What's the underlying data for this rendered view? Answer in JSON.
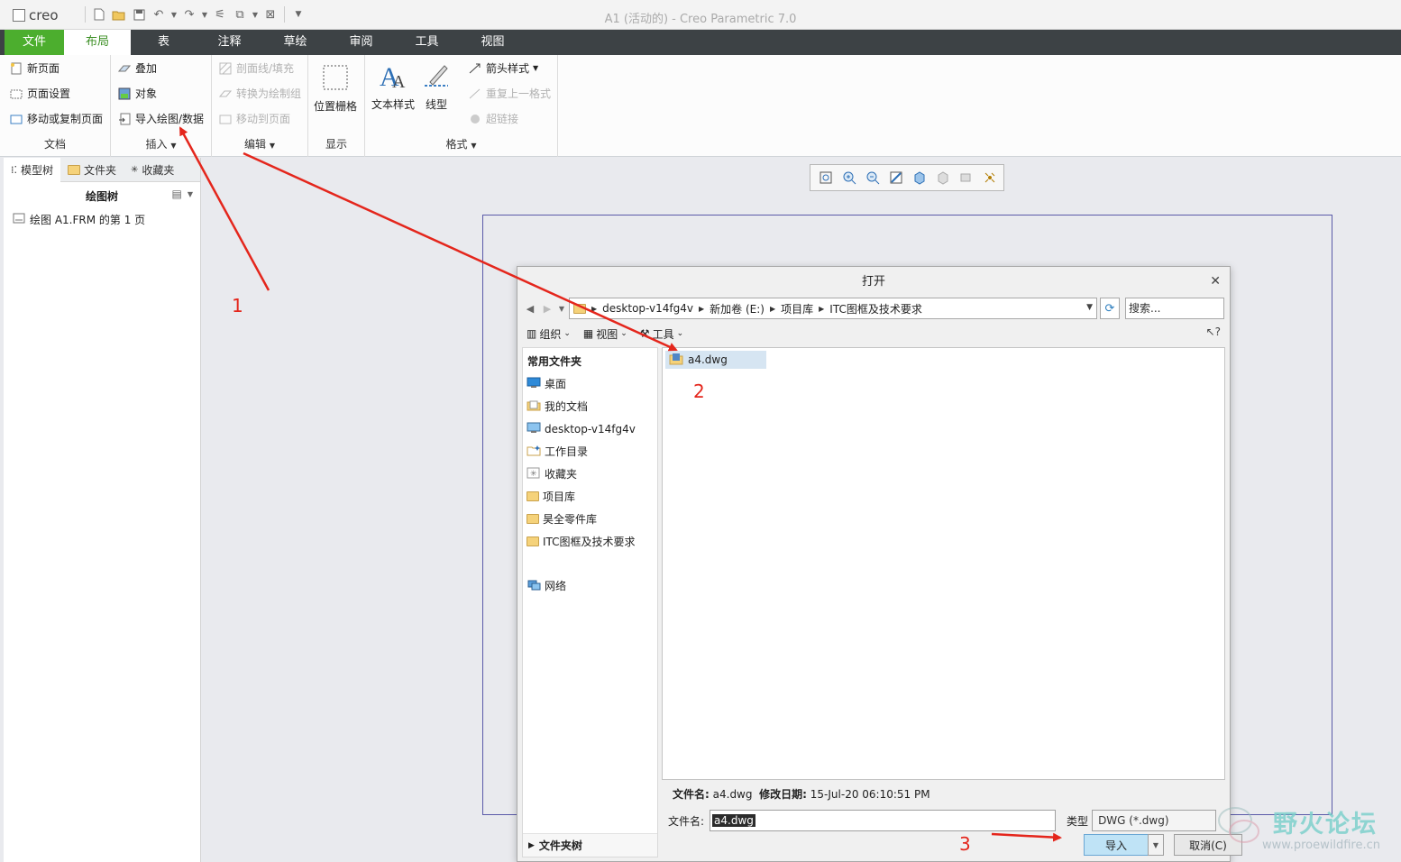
{
  "app": {
    "logo": "creo",
    "window_title": "A1 (活动的) - Creo Parametric 7.0"
  },
  "tabs": [
    "文件",
    "布局",
    "表",
    "注释",
    "草绘",
    "审阅",
    "工具",
    "视图"
  ],
  "ribbon": {
    "doc": {
      "new_page": "新页面",
      "page_setup": "页面设置",
      "move_copy": "移动或复制页面",
      "label": "文档"
    },
    "insert": {
      "overlay": "叠加",
      "object": "对象",
      "import": "导入绘图/数据",
      "label": "插入"
    },
    "edit": {
      "section_line": "剖面线/填充",
      "convert": "转换为绘制组",
      "move_to_page": "移动到页面",
      "label": "编辑"
    },
    "display": {
      "grid": "位置栅格",
      "label": "显示"
    },
    "format": {
      "text_style": "文本样式",
      "line_style": "线型",
      "arrow_style": "箭头样式",
      "repeat_format": "重复上一格式",
      "hyperlink": "超链接",
      "label": "格式"
    }
  },
  "left_panel": {
    "tabs": [
      "模型树",
      "文件夹",
      "收藏夹"
    ],
    "tree_title": "绘图树",
    "tree_item": "绘图 A1.FRM 的第 1 页"
  },
  "dialog": {
    "title": "打开",
    "path": [
      "desktop-v14fg4v",
      "新加卷 (E:)",
      "项目库",
      "ITC图框及技术要求"
    ],
    "search_placeholder": "搜索...",
    "tools": {
      "organize": "组织",
      "view": "视图",
      "tools": "工具",
      "help": "?"
    },
    "favorites_header": "常用文件夹",
    "favorites": [
      "桌面",
      "我的文档",
      "desktop-v14fg4v",
      "工作目录",
      "收藏夹",
      "项目库",
      "昊全零件库",
      "ITC图框及技术要求"
    ],
    "network": "网络",
    "folder_tree": "文件夹树",
    "files": [
      "a4.dwg"
    ],
    "info_label_name": "文件名:",
    "info_name": "a4.dwg",
    "info_label_date": "修改日期:",
    "info_date": "15-Jul-20 06:10:51 PM",
    "filename_label": "文件名:",
    "filename_value": "a4.dwg",
    "type_label": "类型",
    "type_value": "DWG (*.dwg)",
    "import_btn": "导入",
    "cancel_btn": "取消(C)"
  },
  "annotations": [
    "1",
    "2",
    "3"
  ],
  "watermark": {
    "title": "野火论坛",
    "url": "www.proewildfire.cn"
  },
  "colors": {
    "tab_bar": "#3d4245",
    "file_tab": "#4cae2e",
    "active_tab_text": "#3a8e22",
    "arrow": "#e4261c",
    "sheet_border": "#5a5aa8"
  }
}
